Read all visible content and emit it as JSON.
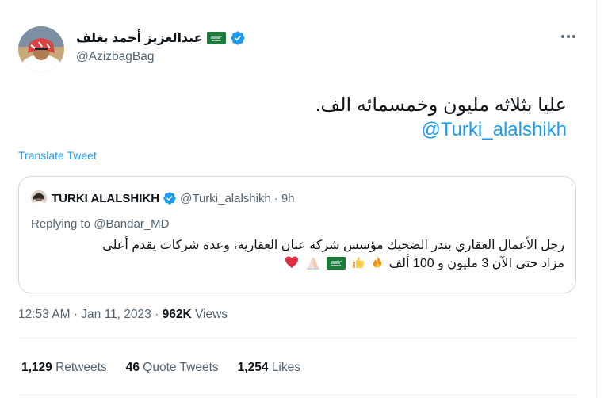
{
  "author": {
    "display_name": "عبدالعزيز أحمد بغلف",
    "handle": "@AzizbagBag"
  },
  "tweet": {
    "text": "عليا بثلاثه مليون وخمسمائه الف.",
    "mention": "@Turki_alalshikh",
    "translate_label": "Translate Tweet",
    "time": "12:53 AM",
    "date": "Jan 11, 2023",
    "views_count": "962K",
    "views_label": "Views",
    "separator": "·"
  },
  "quote": {
    "name": "TURKI ALALSHIKH",
    "handle": "@Turki_alalshikh",
    "dot": "·",
    "time": "9h",
    "replying_prefix": "Replying to",
    "replying_to": "@Bandar_MD",
    "text_line1": "رجل الأعمال العقاري بندر الضحيك مؤسس شركة عنان العقارية، وعدة شركات يقدم أعلى",
    "text_line2": "مزاد حتى الآن 3 مليون و 100 ألف"
  },
  "stats": {
    "retweets_count": "1,129",
    "retweets_label": "Retweets",
    "quotes_count": "46",
    "quotes_label": "Quote Tweets",
    "likes_count": "1,254",
    "likes_label": "Likes"
  },
  "colors": {
    "accent": "#1d9bf0",
    "secondary_text": "#536471",
    "primary_text": "#0f1419",
    "border": "#cfd9de"
  }
}
